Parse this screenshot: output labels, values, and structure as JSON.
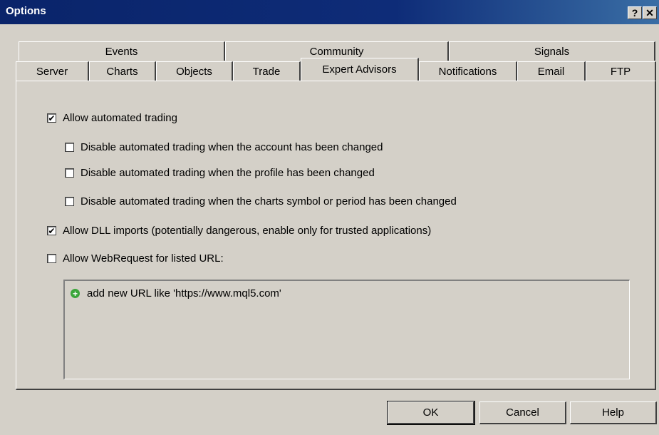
{
  "window": {
    "title": "Options",
    "help_glyph": "?",
    "close_glyph": "✕"
  },
  "tabs_row1": [
    "Events",
    "Community",
    "Signals"
  ],
  "tabs_row2": [
    "Server",
    "Charts",
    "Objects",
    "Trade",
    "Expert Advisors",
    "Notifications",
    "Email",
    "FTP"
  ],
  "active_tab": "Expert Advisors",
  "options": [
    {
      "label": "Allow automated trading",
      "checked": true
    },
    {
      "label": "Disable automated trading when the account has been changed",
      "checked": false
    },
    {
      "label": "Disable automated trading when the profile has been changed",
      "checked": false
    },
    {
      "label": "Disable automated trading when the charts symbol or period has been changed",
      "checked": false
    },
    {
      "label": "Allow DLL imports (potentially dangerous, enable only for trusted applications)",
      "checked": true
    },
    {
      "label": "Allow WebRequest for listed URL:",
      "checked": false
    }
  ],
  "url_list": {
    "add_prompt": "add new URL like 'https://www.mql5.com'"
  },
  "buttons": {
    "ok": "OK",
    "cancel": "Cancel",
    "help": "Help"
  },
  "check_glyph": "✔"
}
